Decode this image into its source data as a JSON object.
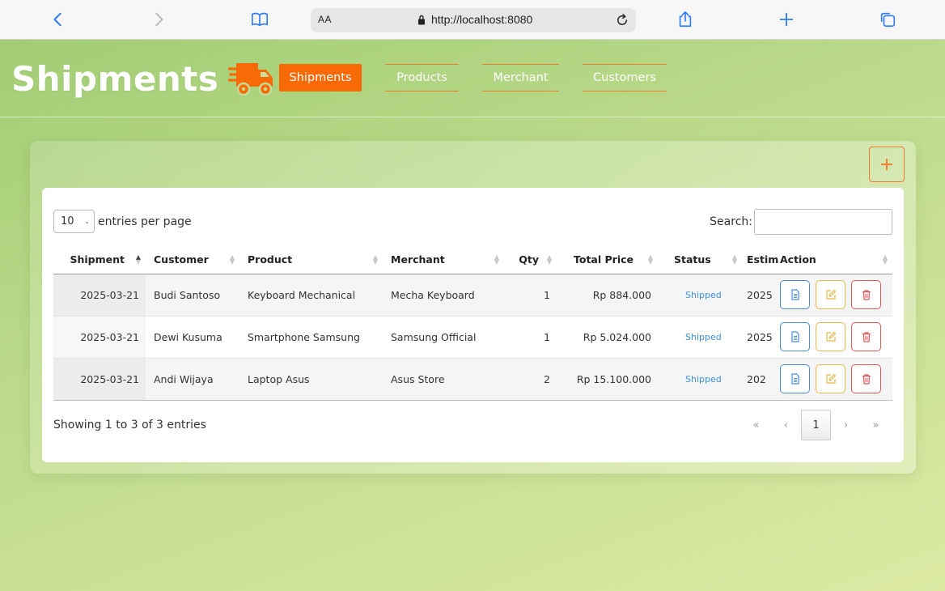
{
  "browser": {
    "text_size_label": "AA",
    "url": "http://localhost:8080"
  },
  "header": {
    "title": "Shipments",
    "nav": [
      {
        "label": "Shipments",
        "active": true
      },
      {
        "label": "Products",
        "active": false
      },
      {
        "label": "Merchant",
        "active": false
      },
      {
        "label": "Customers",
        "active": false
      }
    ]
  },
  "toolbar": {
    "add_label": "+"
  },
  "table_controls": {
    "per_page_value": "10",
    "per_page_label": "entries per page",
    "search_label": "Search:",
    "search_value": ""
  },
  "table": {
    "columns": [
      "Shipment",
      "Customer",
      "Product",
      "Merchant",
      "Qty",
      "Total Price",
      "Status",
      "Estim",
      "Action"
    ],
    "rows": [
      {
        "shipment": "2025-03-21",
        "customer": "Budi Santoso",
        "product": "Keyboard Mechanical",
        "merchant": "Mecha Keyboard",
        "qty": "1",
        "total": "Rp 884.000",
        "status": "Shipped",
        "estim": "2025"
      },
      {
        "shipment": "2025-03-21",
        "customer": "Dewi Kusuma",
        "product": "Smartphone Samsung",
        "merchant": "Samsung Official",
        "qty": "1",
        "total": "Rp 5.024.000",
        "status": "Shipped",
        "estim": "2025"
      },
      {
        "shipment": "2025-03-21",
        "customer": "Andi Wijaya",
        "product": "Laptop Asus",
        "merchant": "Asus Store",
        "qty": "2",
        "total": "Rp 15.100.000",
        "status": "Shipped",
        "estim": "202"
      }
    ]
  },
  "footer": {
    "info": "Showing 1 to 3 of 3 entries",
    "pager": {
      "first": "«",
      "prev": "‹",
      "current": "1",
      "next": "›",
      "last": "»"
    }
  },
  "colors": {
    "accent": "#f86a05",
    "view": "#4a8ee0",
    "edit": "#e8b94a",
    "delete": "#e05656",
    "status": "#3d8fe0"
  }
}
